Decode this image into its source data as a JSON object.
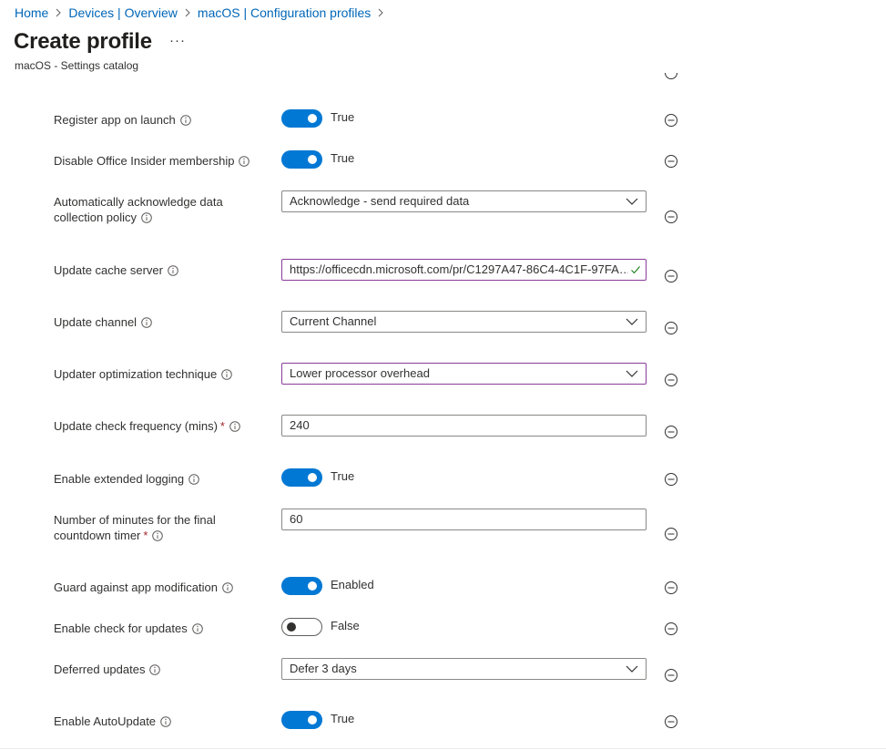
{
  "breadcrumb": [
    {
      "label": "Home"
    },
    {
      "label": "Devices | Overview"
    },
    {
      "label": "macOS | Configuration profiles"
    }
  ],
  "header": {
    "title": "Create profile",
    "more_label": "···",
    "subtitle": "macOS - Settings catalog"
  },
  "settings": [
    {
      "label": "Register app on launch",
      "control": "toggle",
      "on": true,
      "value": "True"
    },
    {
      "label": "Disable Office Insider membership",
      "control": "toggle",
      "on": true,
      "value": "True"
    },
    {
      "label_line1": "Automatically acknowledge data",
      "label_line2": "collection policy",
      "control": "dropdown",
      "value": "Acknowledge - send required data"
    },
    {
      "label": "Update cache server",
      "control": "text",
      "value": "https://officecdn.microsoft.com/pr/C1297A47-86C4-4C1F-97FA…",
      "valid": true
    },
    {
      "label": "Update channel",
      "control": "dropdown",
      "value": "Current Channel"
    },
    {
      "label": "Updater optimization technique",
      "control": "dropdown",
      "value": "Lower processor overhead"
    },
    {
      "label": "Update check frequency (mins)",
      "required_mark": "*",
      "control": "text",
      "value": "240"
    },
    {
      "label": "Enable extended logging",
      "control": "toggle",
      "on": true,
      "value": "True"
    },
    {
      "label_line1": "Number of minutes for the final",
      "label_line2": "countdown timer",
      "required_mark": "*",
      "control": "text",
      "value": "60"
    },
    {
      "label": "Guard against app modification",
      "control": "toggle",
      "on": true,
      "value": "Enabled"
    },
    {
      "label": "Enable check for updates",
      "control": "toggle",
      "on": false,
      "value": "False"
    },
    {
      "label": "Deferred updates",
      "control": "dropdown",
      "value": "Defer 3 days"
    },
    {
      "label": "Enable AutoUpdate",
      "control": "toggle",
      "on": true,
      "value": "True"
    }
  ],
  "icons": {
    "info": "info-icon",
    "remove": "minus-circle-icon",
    "dropdown": "chevron-down-icon",
    "valid": "checkmark-icon",
    "breadcrumb_separator": "chevron-right-icon"
  },
  "colors": {
    "link": "#0066b8",
    "toggle_on": "#0078d4",
    "focus_border": "#8a3b9a",
    "required": "#a4262c",
    "valid_check": "#107c10"
  }
}
